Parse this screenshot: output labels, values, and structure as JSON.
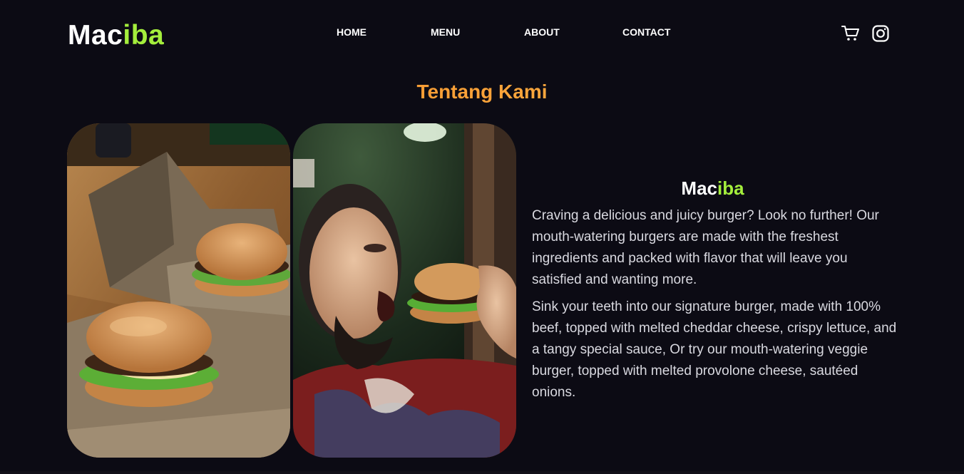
{
  "header": {
    "logo_part1": "Mac",
    "logo_part2": "iba",
    "nav": [
      {
        "label": "HOME"
      },
      {
        "label": "MENU"
      },
      {
        "label": "ABOUT"
      },
      {
        "label": "CONTACT"
      }
    ],
    "icons": [
      "cart-icon",
      "instagram-icon"
    ]
  },
  "about_section": {
    "title": "Tentang Kami",
    "brand_part1": "Mac",
    "brand_part2": "iba",
    "paragraph1": "Craving a delicious and juicy burger? Look no further! Our mouth-watering burgers are made with the freshest ingredients and packed with flavor that will leave you satisfied and wanting more.",
    "paragraph2": "Sink your teeth into our signature burger, made with 100% beef, topped with melted cheddar cheese, crispy lettuce, and a tangy special sauce, Or try our mouth-watering veggie burger, topped with melted provolone cheese, sautéed onions."
  },
  "colors": {
    "background": "#0c0b14",
    "accent_green": "#a4ee3c",
    "title_orange": "#f7831f"
  }
}
